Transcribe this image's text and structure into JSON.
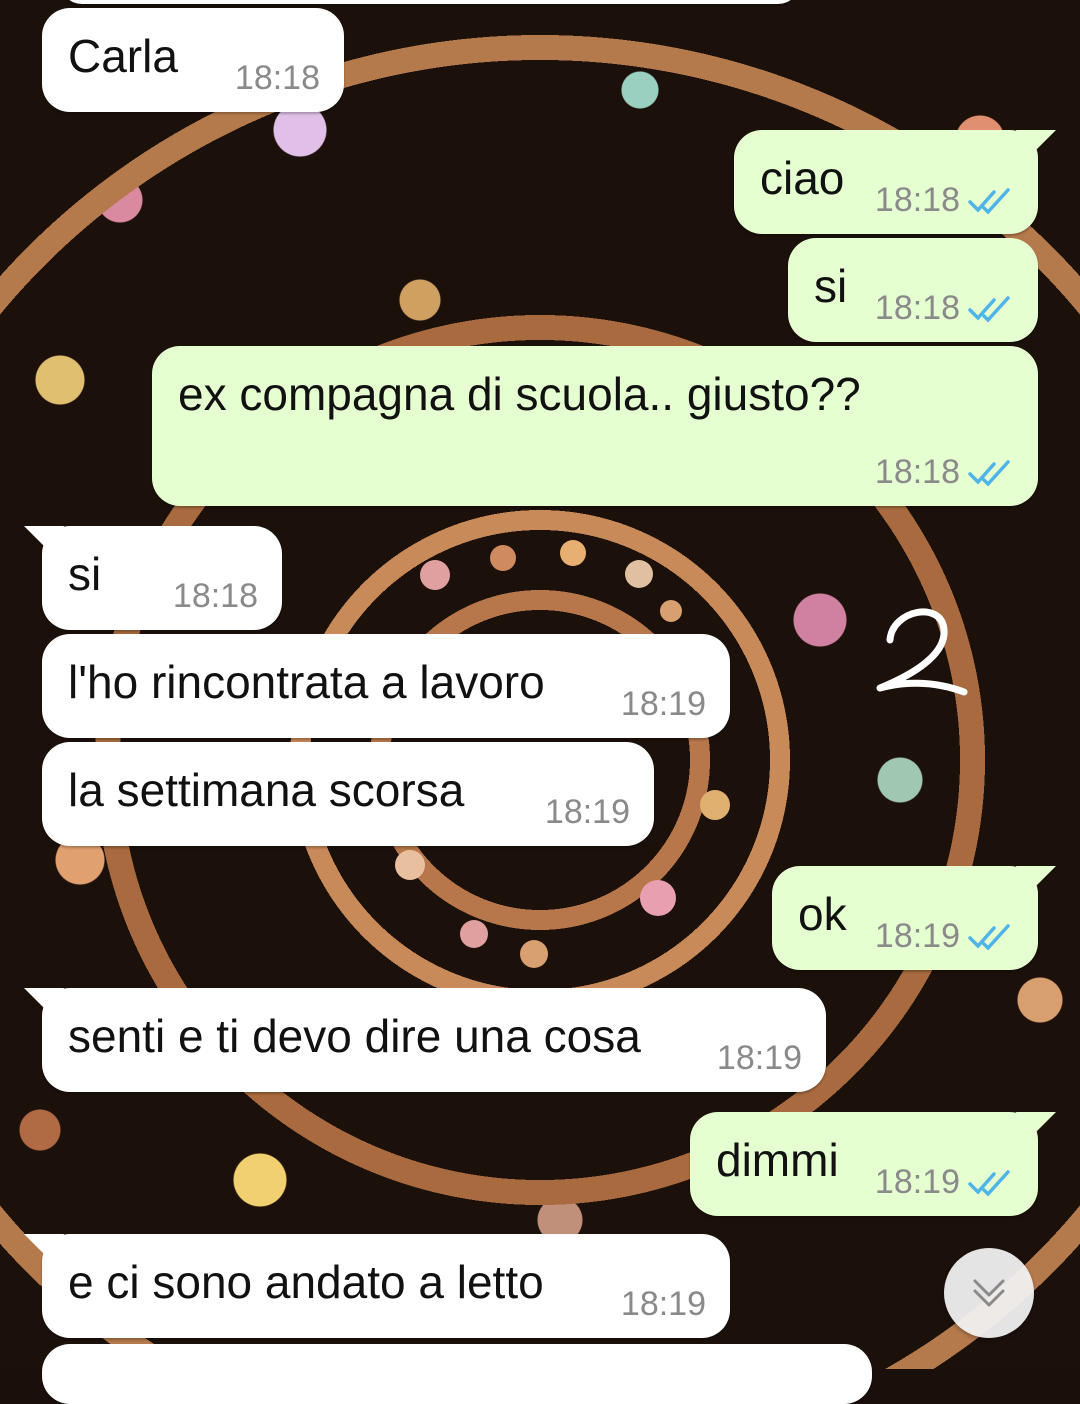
{
  "messages": [
    {
      "direction": "in",
      "text": "Carla",
      "time": "18:18"
    },
    {
      "direction": "out",
      "text": "ciao",
      "time": "18:18",
      "status": "read"
    },
    {
      "direction": "out",
      "text": "si",
      "time": "18:18",
      "status": "read"
    },
    {
      "direction": "out",
      "text": "ex compagna di scuola.. giusto??",
      "time": "18:18",
      "status": "read"
    },
    {
      "direction": "in",
      "text": "si",
      "time": "18:18"
    },
    {
      "direction": "in",
      "text": "l'ho rincontrata a lavoro",
      "time": "18:19"
    },
    {
      "direction": "in",
      "text": "la settimana scorsa",
      "time": "18:19"
    },
    {
      "direction": "out",
      "text": "ok",
      "time": "18:19",
      "status": "read"
    },
    {
      "direction": "in",
      "text": "senti e ti devo dire una cosa",
      "time": "18:19"
    },
    {
      "direction": "out",
      "text": "dimmi",
      "time": "18:19",
      "status": "read"
    },
    {
      "direction": "in",
      "text": "e ci sono andato a letto",
      "time": "18:19"
    }
  ],
  "annotation": {
    "text": "2"
  },
  "icons": {
    "read_receipt": "double-check-icon",
    "scroll_down": "chevron-double-down-icon"
  },
  "colors": {
    "incoming": "#ffffff",
    "outgoing": "#e6ffd0",
    "read_tick": "#4fb4e8",
    "timestamp": "#8a8a8a"
  }
}
